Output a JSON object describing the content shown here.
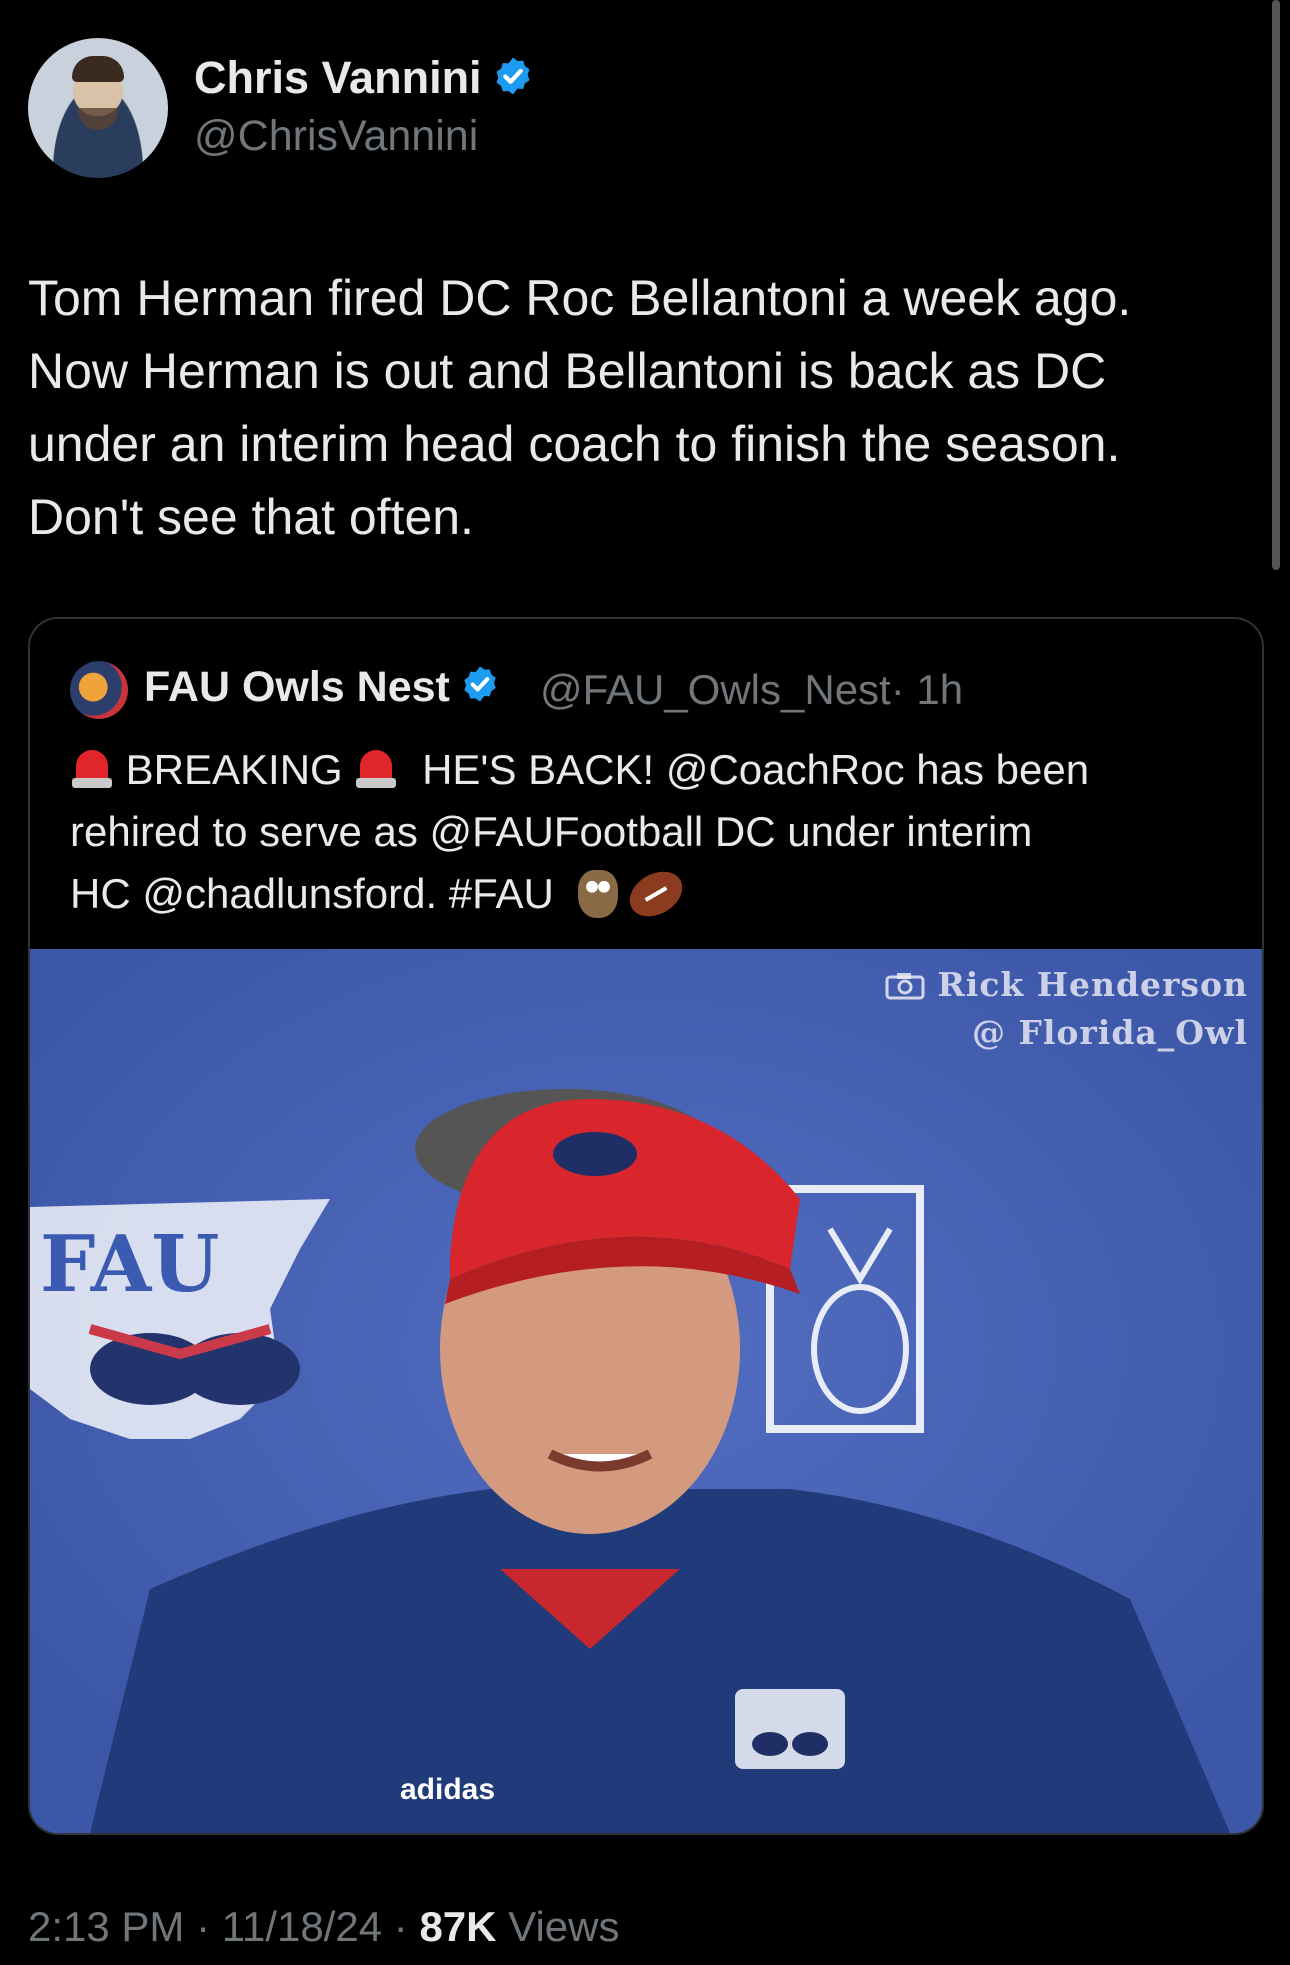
{
  "author": {
    "name": "Chris Vannini",
    "handle": "@ChrisVannini",
    "verified_color": "#1d9bf0",
    "avatar_icon": "profile-photo"
  },
  "tweet": {
    "lines": [
      "Tom Herman fired DC Roc Bellantoni a week ago.",
      "Now Herman is out and Bellantoni is back as DC",
      "under an interim head coach to finish the season.",
      "Don't see that often."
    ]
  },
  "quote": {
    "name": "FAU Owls Nest",
    "handle": "@FAU_Owls_Nest",
    "time": "· 1h",
    "line1_a": "BREAKING",
    "line1_b": "HE'S BACK! @CoachRoc has been",
    "line2": "rehired to serve as @FAUFootball DC under interim",
    "line3": "HC @chadlunsford. #FAU",
    "icons": [
      "police-light-icon",
      "owl-emoji-icon",
      "football-emoji-icon"
    ],
    "photo": {
      "credit_line1": "Rick Henderson",
      "credit_line2": "@ Florida_Owl",
      "logo_text": "FAU",
      "cap_brand": "adidas",
      "background_color": "#4561b5"
    }
  },
  "footer": {
    "time": "2:13 PM",
    "date": "11/18/24",
    "views_count": "87K",
    "views_label": "Views"
  }
}
